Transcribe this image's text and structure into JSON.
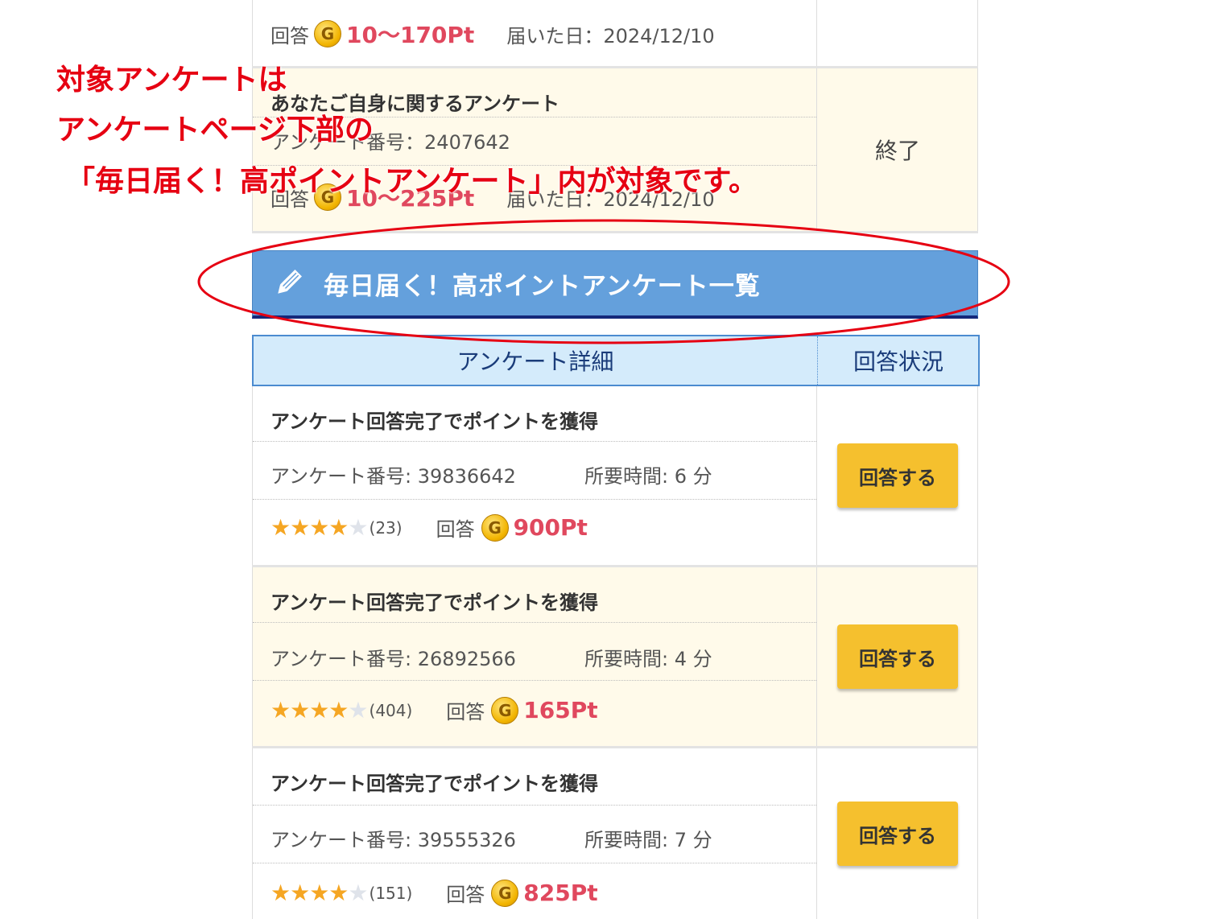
{
  "prev_items": [
    {
      "answer_label": "回答",
      "points": "10〜170Pt",
      "date_label": "届いた日：2024/12/10"
    },
    {
      "title": "あなたご自身に関するアンケート",
      "number_label": "アンケート番号：2407642",
      "answer_label": "回答",
      "points": "10〜225Pt",
      "date_label": "届いた日：2024/12/10",
      "status": "終了"
    }
  ],
  "annotation": {
    "line1": "対象アンケートは",
    "line2": "アンケートページ下部の",
    "line3": "「毎日届く！高ポイントアンケート」内が対象です。"
  },
  "section": {
    "title": "毎日届く！高ポイントアンケート一覧",
    "icon": "pencil-icon"
  },
  "table_header": {
    "detail": "アンケート詳細",
    "status": "回答状況"
  },
  "surveys": [
    {
      "title": "アンケート回答完了でポイントを獲得",
      "number": "アンケート番号: 39836642",
      "time": "所要時間: 6 分",
      "rating": 4,
      "count": "(23)",
      "answer_label": "回答",
      "coin": "G",
      "points": "900Pt",
      "button": "回答する"
    },
    {
      "title": "アンケート回答完了でポイントを獲得",
      "number": "アンケート番号: 26892566",
      "time": "所要時間: 4 分",
      "rating": 4,
      "count": "(404)",
      "answer_label": "回答",
      "coin": "G",
      "points": "165Pt",
      "button": "回答する"
    },
    {
      "title": "アンケート回答完了でポイントを獲得",
      "number": "アンケート番号: 39555326",
      "time": "所要時間: 7 分",
      "rating": 4,
      "count": "(151)",
      "answer_label": "回答",
      "coin": "G",
      "points": "825Pt",
      "button": "回答する"
    }
  ],
  "colors": {
    "section_bg": "#64a0dc",
    "section_border": "#14287a",
    "header_bg": "#d4ebfb",
    "points": "#e0485e",
    "button": "#f5c02e",
    "annotation": "#e60012",
    "alt_row_bg": "#fffaea"
  }
}
